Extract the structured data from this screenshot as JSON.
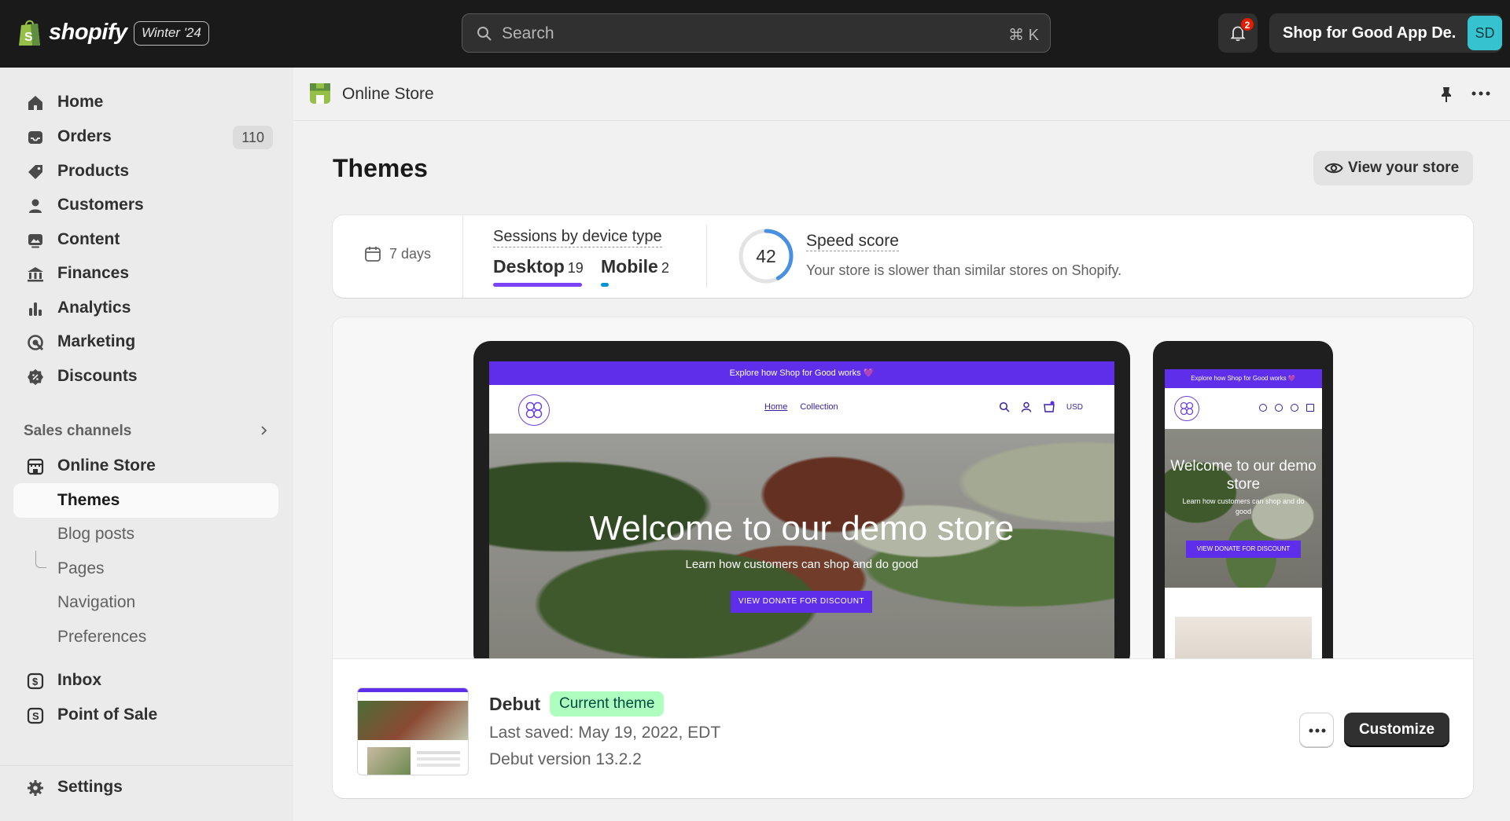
{
  "topbar": {
    "brand": "shopify",
    "edition": "Winter '24",
    "search_placeholder": "Search",
    "search_shortcut": "⌘ K",
    "notification_count": "2",
    "store_name": "Shop for Good App De...",
    "avatar_initials": "SD"
  },
  "sidebar": {
    "items": [
      {
        "label": "Home",
        "icon": "home-icon"
      },
      {
        "label": "Orders",
        "icon": "inbox-tray-icon",
        "count": "110"
      },
      {
        "label": "Products",
        "icon": "tag-icon"
      },
      {
        "label": "Customers",
        "icon": "person-icon"
      },
      {
        "label": "Content",
        "icon": "image-content-icon"
      },
      {
        "label": "Finances",
        "icon": "bank-icon"
      },
      {
        "label": "Analytics",
        "icon": "bar-chart-icon"
      },
      {
        "label": "Marketing",
        "icon": "target-icon"
      },
      {
        "label": "Discounts",
        "icon": "discount-badge-icon"
      }
    ],
    "sales_channels_title": "Sales channels",
    "online_store": "Online Store",
    "sub_items": [
      "Themes",
      "Blog posts",
      "Pages",
      "Navigation",
      "Preferences"
    ],
    "apps": [
      {
        "label": "Inbox",
        "icon": "chat-icon"
      },
      {
        "label": "Point of Sale",
        "icon": "pos-icon"
      }
    ],
    "settings": "Settings"
  },
  "header": {
    "section_title": "Online Store"
  },
  "main": {
    "page_title": "Themes",
    "view_store_label": "View your store",
    "stats": {
      "date_range": "7 days",
      "sessions_title": "Sessions by device type",
      "desktop_label": "Desktop",
      "desktop_count": "19",
      "mobile_label": "Mobile",
      "mobile_count": "2",
      "speed_score": "42",
      "speed_score_fraction": 0.42,
      "speed_title": "Speed score",
      "speed_desc": "Your store is slower than similar stores on Shopify."
    },
    "preview": {
      "announcement": "Explore how Shop for Good works 💜",
      "nav_home": "Home",
      "nav_collection": "Collection",
      "currency": "USD",
      "hero_title": "Welcome to our demo store",
      "hero_subtitle": "Learn how customers can shop and do good",
      "hero_button": "VIEW DONATE FOR DISCOUNT",
      "mobile_title": "Welcome to our demo store",
      "mobile_subtitle": "Learn how customers can shop and do good",
      "mobile_button": "VIEW DONATE FOR DISCOUNT",
      "mobile_announcement": "Explore how Shop for Good works 💜"
    },
    "theme": {
      "name": "Debut",
      "badge": "Current theme",
      "last_saved": "Last saved: May 19, 2022, EDT",
      "version": "Debut version 13.2.2",
      "customize_label": "Customize"
    }
  },
  "colors": {
    "topbar": "#1a1a1a",
    "accent_purple": "#5e2eea",
    "desktop_bar": "#7b42f6",
    "mobile_bar": "#0094d5",
    "badge_green": "#affebf",
    "avatar": "#36c3cf",
    "speed_ring": "#4a90e2"
  }
}
